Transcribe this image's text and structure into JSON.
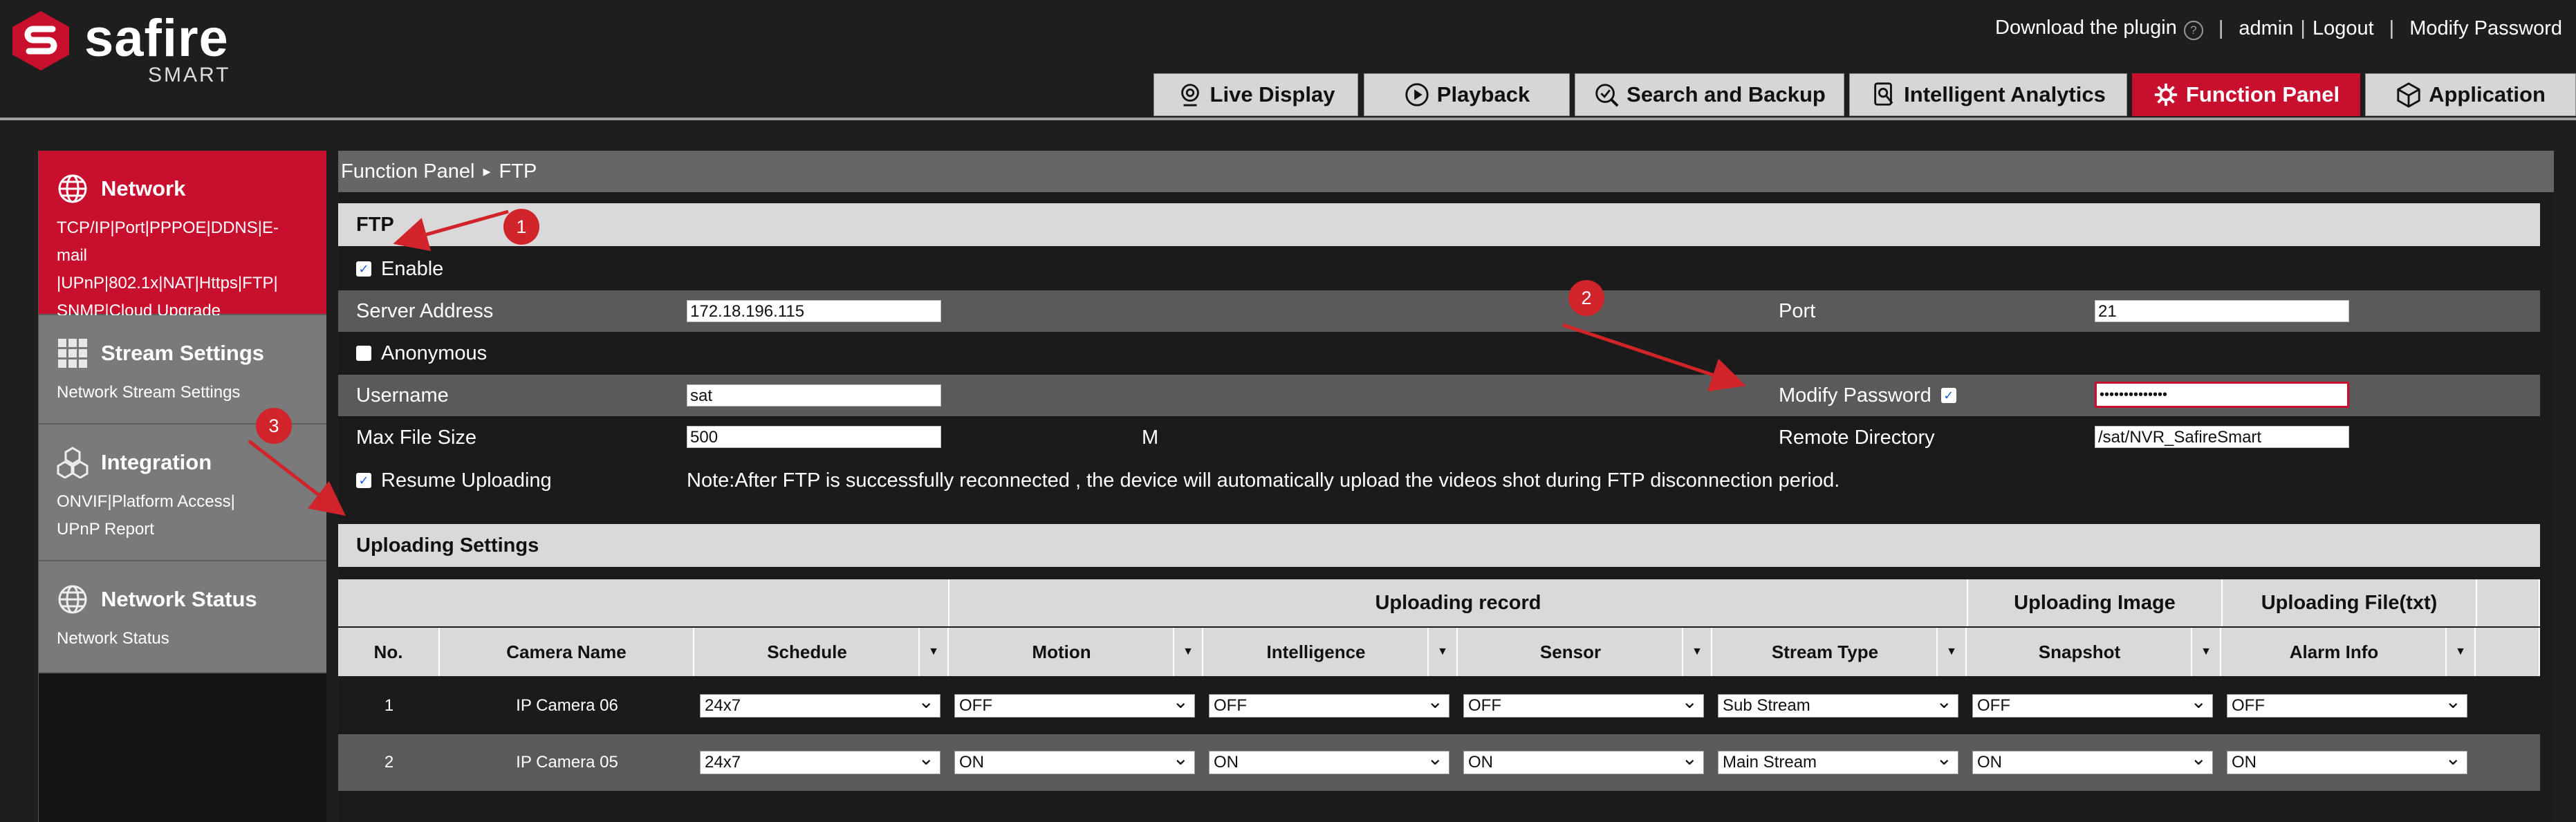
{
  "brand": {
    "name": "safire",
    "sub": "SMART"
  },
  "header": {
    "download_plugin": "Download the plugin",
    "help_icon": "?",
    "sep": "|",
    "user": "admin",
    "logout": "Logout",
    "modify_password": "Modify Password"
  },
  "nav": {
    "tabs": [
      {
        "label": "Live Display",
        "icon": "webcam-icon"
      },
      {
        "label": "Playback",
        "icon": "play-icon"
      },
      {
        "label": "Search and Backup",
        "icon": "search-backup-icon"
      },
      {
        "label": "Intelligent Analytics",
        "icon": "analytics-icon"
      },
      {
        "label": "Function Panel",
        "icon": "gear-icon",
        "active": true
      },
      {
        "label": "Application",
        "icon": "cube-icon"
      }
    ]
  },
  "sidebar": {
    "items": [
      {
        "title": "Network",
        "desc_lines": [
          "TCP/IP|Port|PPPOE|DDNS|E-mail",
          "|UPnP|802.1x|NAT|Https|FTP|",
          "SNMP|Cloud Upgrade"
        ],
        "active": true,
        "icon": "globe-icon"
      },
      {
        "title": "Stream Settings",
        "desc_lines": [
          "Network Stream Settings"
        ],
        "icon": "grid-icon"
      },
      {
        "title": "Integration",
        "desc_lines": [
          "ONVIF|Platform Access|",
          "UPnP Report"
        ],
        "icon": "cubes-icon"
      },
      {
        "title": "Network Status",
        "desc_lines": [
          "Network Status"
        ],
        "icon": "globe-icon"
      }
    ]
  },
  "breadcrumb": {
    "root": "Function Panel",
    "sep": "▸",
    "current": "FTP"
  },
  "ftp": {
    "section_title": "FTP",
    "enable_label": "Enable",
    "enable_checked": true,
    "server_address_label": "Server Address",
    "server_address": "172.18.196.115",
    "port_label": "Port",
    "port": "21",
    "anonymous_label": "Anonymous",
    "anonymous_checked": false,
    "username_label": "Username",
    "username": "sat",
    "modify_password_label": "Modify Password",
    "modify_password_checked": true,
    "password": "••••••••••••••",
    "max_file_size_label": "Max File Size",
    "max_file_size": "500",
    "max_file_size_unit": "M",
    "remote_directory_label": "Remote Directory",
    "remote_directory": "/sat/NVR_SafireSmart",
    "resume_uploading_label": "Resume Uploading",
    "resume_uploading_checked": true,
    "note": "Note:After FTP is successfully reconnected , the device will automatically upload the videos shot during FTP disconnection period."
  },
  "uploading": {
    "section_title": "Uploading Settings",
    "group_headers": {
      "record": "Uploading record",
      "image": "Uploading Image",
      "file": "Uploading File(txt)"
    },
    "columns": [
      "No.",
      "Camera Name",
      "Schedule",
      "Motion",
      "Intelligence",
      "Sensor",
      "Stream Type",
      "Snapshot",
      "Alarm Info"
    ],
    "rows": [
      {
        "no": "1",
        "camera": "IP Camera 06",
        "schedule": "24x7",
        "motion": "OFF",
        "intelligence": "OFF",
        "sensor": "OFF",
        "stream": "Sub Stream",
        "snapshot": "OFF",
        "alarm": "OFF"
      },
      {
        "no": "2",
        "camera": "IP Camera 05",
        "schedule": "24x7",
        "motion": "ON",
        "intelligence": "ON",
        "sensor": "ON",
        "stream": "Main Stream",
        "snapshot": "ON",
        "alarm": "ON"
      }
    ]
  },
  "annotations": {
    "badges": [
      "1",
      "2",
      "3"
    ]
  },
  "colors": {
    "accent": "#c8102e",
    "background": "#1e1e1e",
    "band_gray": "#5a5a5a",
    "header_light": "#d9d9d9",
    "annotation_red": "#d0232a"
  }
}
